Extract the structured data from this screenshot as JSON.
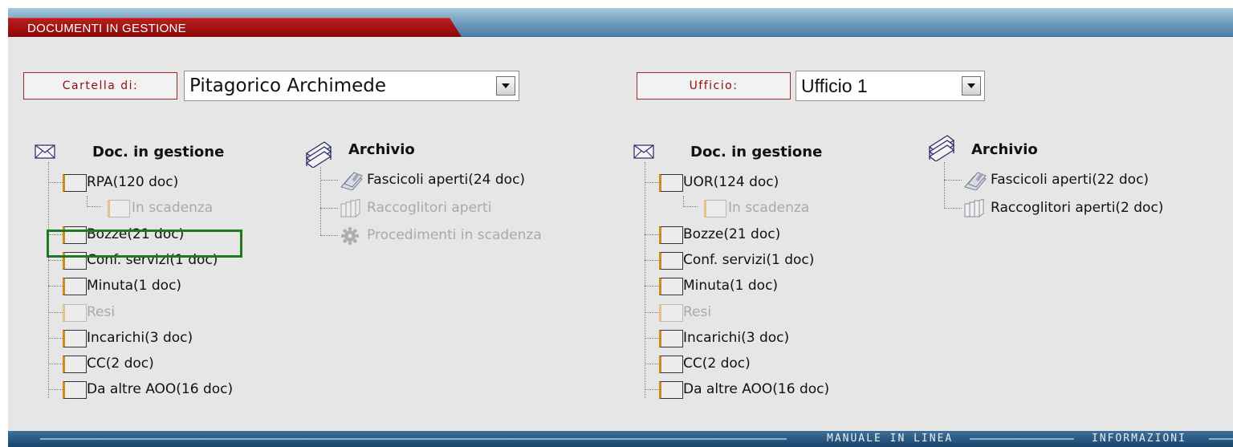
{
  "header": {
    "tab_title": "DOCUMENTI IN GESTIONE"
  },
  "filters": {
    "cartella_label": "Cartella di:",
    "cartella_value": "Pitagorico Archimede",
    "ufficio_label": "Ufficio:",
    "ufficio_value": "Ufficio 1"
  },
  "left": {
    "doc_title": "Doc. in gestione",
    "nodes": [
      {
        "label": "RPA(120 doc)"
      },
      {
        "label": "In scadenza",
        "disabled": true,
        "sub": true
      },
      {
        "label": "Bozze(21 doc)",
        "selected": true
      },
      {
        "label": "Conf. servizi(1 doc)"
      },
      {
        "label": "Minuta(1 doc)"
      },
      {
        "label": "Resi",
        "disabled": true
      },
      {
        "label": "Incarichi(3 doc)"
      },
      {
        "label": "CC(2 doc)"
      },
      {
        "label": "Da altre AOO(16 doc)"
      }
    ],
    "archive_title": "Archivio",
    "archive_items": [
      {
        "label": "Fascicoli aperti(24 doc)",
        "icon": "folder-tools-icon"
      },
      {
        "label": "Raccoglitori aperti",
        "icon": "binders-icon",
        "disabled": true
      },
      {
        "label": "Procedimenti in scadenza",
        "icon": "gear-icon",
        "disabled": true
      }
    ]
  },
  "right": {
    "doc_title": "Doc. in gestione",
    "nodes": [
      {
        "label": "UOR(124 doc)"
      },
      {
        "label": "In scadenza",
        "disabled": true,
        "sub": true
      },
      {
        "label": "Bozze(21 doc)"
      },
      {
        "label": "Conf. servizi(1 doc)"
      },
      {
        "label": "Minuta(1 doc)"
      },
      {
        "label": "Resi",
        "disabled": true
      },
      {
        "label": "Incarichi(3 doc)"
      },
      {
        "label": "CC(2 doc)"
      },
      {
        "label": "Da altre AOO(16 doc)"
      }
    ],
    "archive_title": "Archivio",
    "archive_items": [
      {
        "label": "Fascicoli aperti(22 doc)",
        "icon": "folder-tools-icon"
      },
      {
        "label": "Raccoglitori aperti(2 doc)",
        "icon": "binders-icon"
      }
    ]
  },
  "footer": {
    "manual_link": "MANUALE IN LINEA",
    "info_link": "INFORMAZIONI"
  },
  "colors": {
    "tab_red": "#8a0808",
    "selection_green": "#1e7a1e",
    "folder_accent": "#d08a22"
  }
}
